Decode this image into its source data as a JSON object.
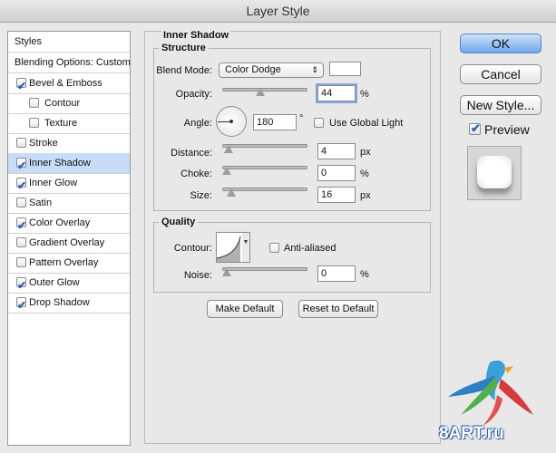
{
  "window": {
    "title": "Layer Style"
  },
  "sidebar": {
    "header": "Styles",
    "blending": "Blending Options: Custom",
    "items": [
      {
        "label": "Bevel & Emboss",
        "checked": true,
        "selected": false,
        "indent": false
      },
      {
        "label": "Contour",
        "checked": false,
        "selected": false,
        "indent": true
      },
      {
        "label": "Texture",
        "checked": false,
        "selected": false,
        "indent": true
      },
      {
        "label": "Stroke",
        "checked": false,
        "selected": false,
        "indent": false
      },
      {
        "label": "Inner Shadow",
        "checked": true,
        "selected": true,
        "indent": false
      },
      {
        "label": "Inner Glow",
        "checked": true,
        "selected": false,
        "indent": false
      },
      {
        "label": "Satin",
        "checked": false,
        "selected": false,
        "indent": false
      },
      {
        "label": "Color Overlay",
        "checked": true,
        "selected": false,
        "indent": false
      },
      {
        "label": "Gradient Overlay",
        "checked": false,
        "selected": false,
        "indent": false
      },
      {
        "label": "Pattern Overlay",
        "checked": false,
        "selected": false,
        "indent": false
      },
      {
        "label": "Outer Glow",
        "checked": true,
        "selected": false,
        "indent": false
      },
      {
        "label": "Drop Shadow",
        "checked": true,
        "selected": false,
        "indent": false
      }
    ]
  },
  "panel": {
    "title": "Inner Shadow",
    "structure": {
      "legend": "Structure",
      "blend_mode_label": "Blend Mode:",
      "blend_mode_value": "Color Dodge",
      "color_swatch": "#ffffff",
      "opacity_label": "Opacity:",
      "opacity_value": "44",
      "opacity_unit": "%",
      "opacity_level": 0.44,
      "angle_label": "Angle:",
      "angle_value": "180",
      "angle_unit": "°",
      "use_global_light_label": "Use Global Light",
      "use_global_light_checked": false,
      "distance_label": "Distance:",
      "distance_value": "4",
      "distance_unit": "px",
      "distance_level": 0.02,
      "choke_label": "Choke:",
      "choke_value": "0",
      "choke_unit": "%",
      "choke_level": 0.0,
      "size_label": "Size:",
      "size_value": "16",
      "size_unit": "px",
      "size_level": 0.065
    },
    "quality": {
      "legend": "Quality",
      "contour_label": "Contour:",
      "anti_aliased_label": "Anti-aliased",
      "anti_aliased_checked": false,
      "noise_label": "Noise:",
      "noise_value": "0",
      "noise_unit": "%",
      "noise_level": 0.0
    },
    "make_default_label": "Make Default",
    "reset_default_label": "Reset to Default"
  },
  "actions": {
    "ok_label": "OK",
    "cancel_label": "Cancel",
    "new_style_label": "New Style...",
    "preview_label": "Preview",
    "preview_checked": true
  },
  "watermark": {
    "text": "8ART.ru"
  }
}
